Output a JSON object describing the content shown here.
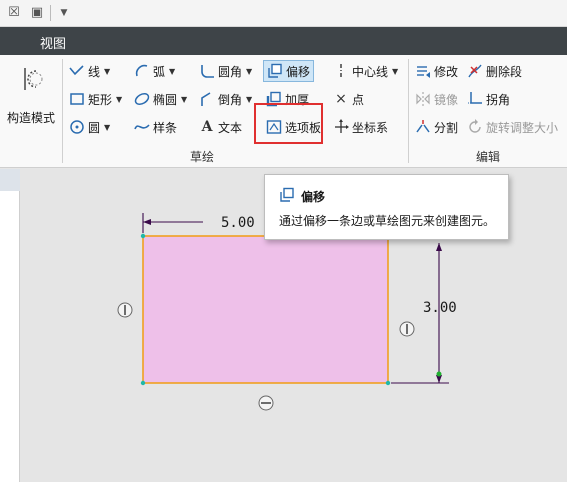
{
  "ribbon_tab": "视图",
  "mode_button": "构造模式",
  "sketch_group": {
    "label": "草绘",
    "line": "线",
    "arc": "弧",
    "fillet": "圆角",
    "offset": "偏移",
    "centerline": "中心线",
    "rectangle": "矩形",
    "ellipse": "椭圆",
    "chamfer": "倒角",
    "thicken": "加厚",
    "point": "点",
    "circle": "圆",
    "spline": "样条",
    "text": "文本",
    "palette": "选项板",
    "coordinate_system": "坐标系"
  },
  "edit_group": {
    "label": "编辑",
    "modify": "修改",
    "delete_segment": "删除段",
    "mirror": "镜像",
    "corner": "拐角",
    "divide": "分割",
    "rotate_resize": "旋转调整大小"
  },
  "tooltip": {
    "title": "偏移",
    "description": "通过偏移一条边或草绘图元来创建图元。"
  },
  "sketch": {
    "width_dim": "5.00",
    "height_dim": "3.00",
    "fill_color": "#eec0e9",
    "edge_color": "#f0a020",
    "vertex_color": "#20b8a8"
  }
}
